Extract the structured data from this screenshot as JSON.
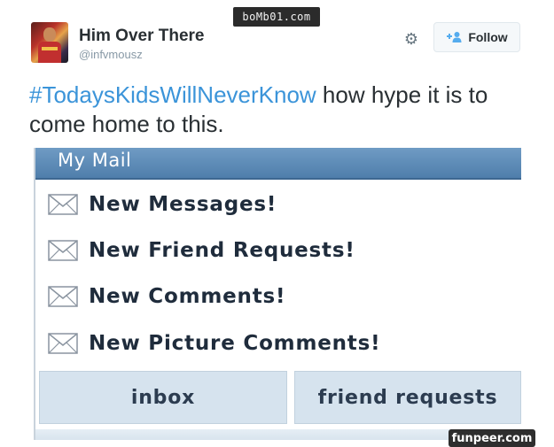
{
  "watermarks": {
    "top": "boMb01.com",
    "bottom": "funpeer.com"
  },
  "tweet": {
    "display_name": "Him Over There",
    "handle": "@infvmousz",
    "follow_label": "Follow",
    "hashtag": "#TodaysKidsWillNeverKnow",
    "text": " how hype it is to come home to this."
  },
  "icons": {
    "settings": "gear-icon",
    "follow": "add-user-icon",
    "mail": "envelope-icon"
  },
  "colors": {
    "hashtag": "#3b94d9",
    "mail_header": "#5a86b3",
    "tab_bg": "#d6e3ee"
  },
  "embedded": {
    "title": "My Mail",
    "items": [
      {
        "label": "New Messages!"
      },
      {
        "label": "New Friend Requests!"
      },
      {
        "label": "New Comments!"
      },
      {
        "label": "New Picture Comments!"
      }
    ],
    "tabs": [
      {
        "label": "inbox"
      },
      {
        "label": "friend requests"
      }
    ]
  }
}
